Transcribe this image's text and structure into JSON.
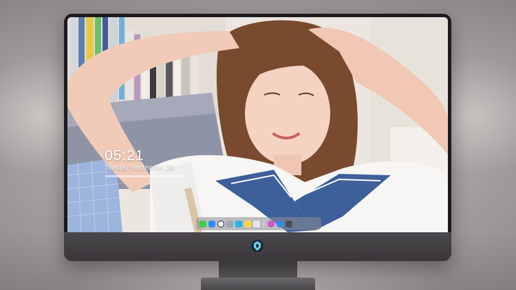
{
  "lock_screen": {
    "time": "05:21",
    "date": "Sunday September 28"
  },
  "dock": {
    "apps": [
      {
        "name": "messages-icon",
        "color": "#3ecf4a"
      },
      {
        "name": "mail-icon",
        "color": "#2f8ef5"
      },
      {
        "name": "clock-icon",
        "color": "#f2f2f2"
      },
      {
        "name": "preview-icon",
        "color": "#9aa7b4"
      },
      {
        "name": "claquette-icon",
        "color": "#25b3e8"
      },
      {
        "name": "notes-icon",
        "color": "#f6d64a"
      },
      {
        "name": "photos-icon",
        "color": "#e9e5ec"
      },
      {
        "name": "itunes-icon",
        "color": "#d84fd2"
      },
      {
        "name": "app-store-icon",
        "color": "#2e8cf1"
      },
      {
        "name": "camera-icon",
        "color": "#4c4c52"
      }
    ]
  },
  "colors": {
    "monitor_bezel": "#1c1b1f",
    "monitor_chin": "#403d41"
  }
}
